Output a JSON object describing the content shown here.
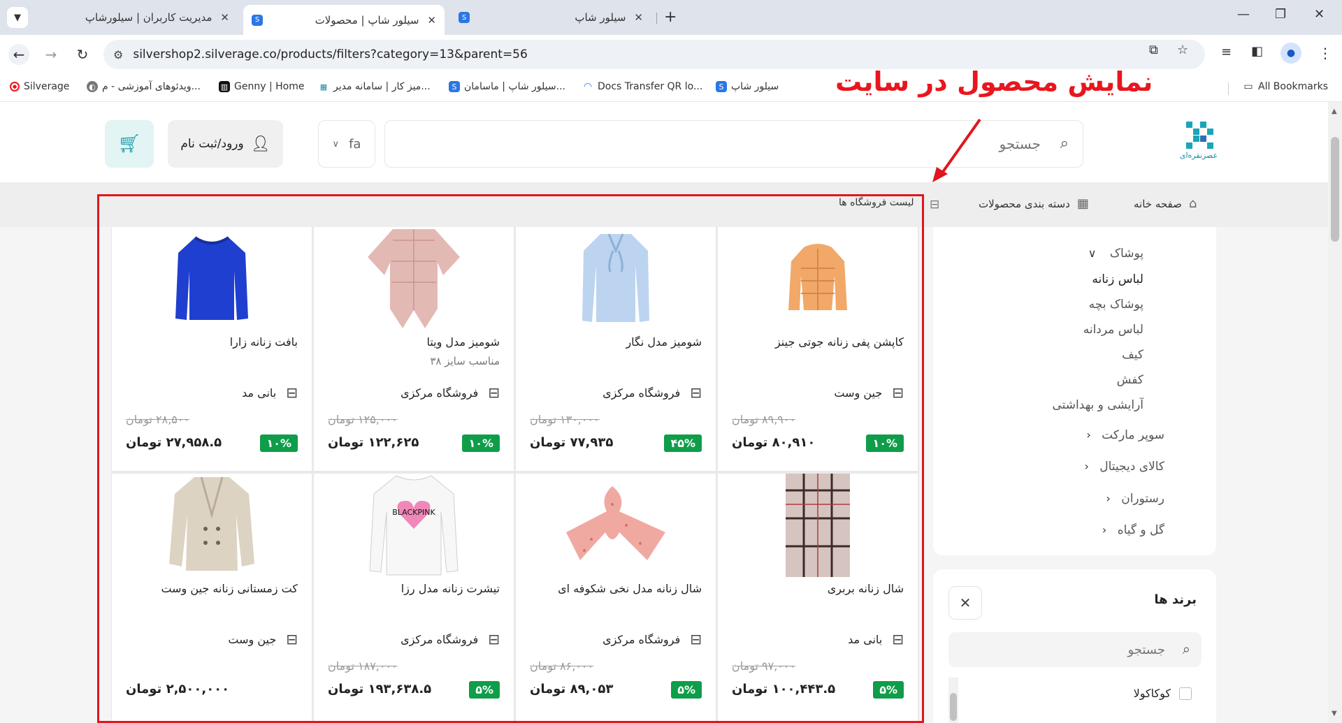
{
  "browser": {
    "tabs": [
      {
        "title": "مدیریت کاربران | سیلورشاپ",
        "close": "✕"
      },
      {
        "title": "سیلور شاپ | محصولات",
        "close": "✕"
      },
      {
        "title": "سیلور شاپ",
        "close": "✕"
      }
    ],
    "url": "silvershop2.silverage.co/products/filters?category=13&parent=56",
    "bookmarks": [
      "Silverage",
      "ویدئوهای آموزشی - م...",
      "Genny | Home",
      "میز کار | سامانه مدیر...",
      "سیلور شاپ | ماسامان...",
      "Docs Transfer QR lo...",
      "سیلور شاپ"
    ],
    "all_bookmarks": "All Bookmarks"
  },
  "annotation": {
    "text": "نمایش محصول در سایت",
    "color": "#e8161e"
  },
  "header": {
    "logo_text": "عصرنقره‌ای",
    "search_placeholder": "جستجو",
    "language": "fa",
    "login_label": "ورود/ثبت نام"
  },
  "nav": {
    "home": "صفحه خانه",
    "categories": "دسته بندی محصولات",
    "stores": "لیست فروشگاه ها"
  },
  "sidebar": {
    "parent": "پوشاک",
    "subcategories": [
      "لباس زنانه",
      "پوشاک بچه",
      "لباس مردانه",
      "کیف",
      "کفش",
      "آرایشی و بهداشتی"
    ],
    "collapsed": [
      "سوپر مارکت",
      "کالای دیجیتال",
      "رستوران",
      "گل و گیاه"
    ]
  },
  "brands": {
    "title": "برند ها",
    "search_placeholder": "جستجو",
    "options": [
      "کوکاکولا"
    ]
  },
  "products": [
    {
      "name": "کاپشن پفی زنانه جوتی جینز",
      "desc": "",
      "store": "جین وست",
      "old_price": "۸۹,۹۰۰ تومان",
      "price": "۸۰,۹۱۰ تومان",
      "discount": "۱۰%",
      "image": "puffer-jacket"
    },
    {
      "name": "شومیز مدل نگار",
      "desc": "",
      "store": "فروشگاه مرکزی",
      "old_price": "۱۳۰,۰۰۰ تومان",
      "price": "۷۷,۹۳۵ تومان",
      "discount": "۴۵%",
      "image": "blue-blouse"
    },
    {
      "name": "شومیز مدل ویتا",
      "desc": "مناسب سایز ۳۸",
      "store": "فروشگاه مرکزی",
      "old_price": "۱۲۵,۰۰۰ تومان",
      "price": "۱۲۲,۶۲۵ تومان",
      "discount": "۱۰%",
      "image": "pink-blouse"
    },
    {
      "name": "بافت زنانه زارا",
      "desc": "",
      "store": "بانی مد",
      "old_price": "۲۸,۵۰۰ تومان",
      "price": "۲۷,۹۵۸.۵ تومان",
      "discount": "۱۰%",
      "image": "blue-sweater"
    },
    {
      "name": "شال زنانه بربری",
      "desc": "",
      "store": "بانی مد",
      "old_price": "۹۷,۰۰۰ تومان",
      "price": "۱۰۰,۴۴۳.۵ تومان",
      "discount": "۵%",
      "image": "plaid-scarf"
    },
    {
      "name": "شال زنانه مدل نخی شکوفه ای",
      "desc": "",
      "store": "فروشگاه مرکزی",
      "old_price": "۸۶,۰۰۰ تومان",
      "price": "۸۹,۰۵۳ تومان",
      "discount": "۵%",
      "image": "pink-scarf"
    },
    {
      "name": "تیشرت زنانه مدل رزا",
      "desc": "",
      "store": "فروشگاه مرکزی",
      "old_price": "۱۸۷,۰۰۰ تومان",
      "price": "۱۹۳,۶۳۸.۵ تومان",
      "discount": "۵%",
      "image": "white-tshirt"
    },
    {
      "name": "کت زمستانی زنانه جین وست",
      "desc": "",
      "store": "جین وست",
      "old_price": "",
      "price": "۲,۵۰۰,۰۰۰ تومان",
      "discount": "",
      "image": "beige-coat"
    }
  ],
  "tshirt_print": "BLACKPINK"
}
